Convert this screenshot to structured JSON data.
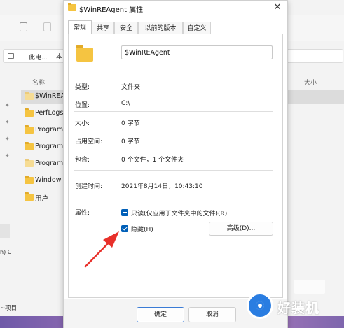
{
  "explorer": {
    "address_text": "此电...",
    "address_frag": "本",
    "column_name": "名称",
    "column_size": "大小",
    "files": [
      {
        "label": "$WinREA"
      },
      {
        "label": "PerfLogs"
      },
      {
        "label": "Program"
      },
      {
        "label": "Program"
      },
      {
        "label": "Program"
      },
      {
        "label": "Window"
      },
      {
        "label": "用户"
      }
    ],
    "left_fragment": "h) C",
    "status_text": "~项目"
  },
  "dialog": {
    "title": "$WinREAgent 属性",
    "close_glyph": "✕",
    "tabs": [
      {
        "label": "常规"
      },
      {
        "label": "共享"
      },
      {
        "label": "安全"
      },
      {
        "label": "以前的版本"
      },
      {
        "label": "自定义"
      }
    ],
    "active_tab": "常规",
    "name_value": "$WinREAgent",
    "properties": {
      "type_label": "类型:",
      "type_value": "文件夹",
      "location_label": "位置:",
      "location_value": "C:\\",
      "size_label": "大小:",
      "size_value": "0 字节",
      "disk_size_label": "占用空间:",
      "disk_size_value": "0 字节",
      "contains_label": "包含:",
      "contains_value": "0 个文件，1 个文件夹",
      "created_label": "创建时间:",
      "created_value": "2021年8月14日，10:43:10",
      "attributes_label": "属性:"
    },
    "attributes": {
      "readonly_label": "只读(仅应用于文件夹中的文件)(R)",
      "readonly_state": "indeterminate",
      "hidden_label": "隐藏(H)",
      "hidden_state": "checked",
      "advanced_button": "高级(D)..."
    },
    "buttons": {
      "ok": "确定",
      "cancel": "取消"
    }
  },
  "watermark": {
    "text": "好装机"
  },
  "colors": {
    "accent": "#005fb8",
    "folder": "#f5c441",
    "arrow": "#e8302a",
    "watermark_blue": "#2a7de1"
  }
}
